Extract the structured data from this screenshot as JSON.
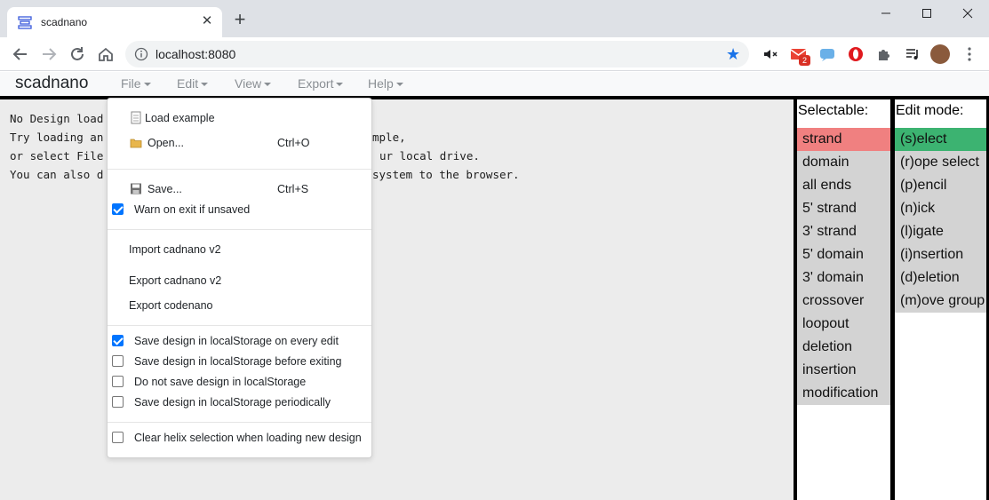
{
  "browser": {
    "tab_title": "scadnano",
    "url": "localhost:8080",
    "gmail_badge": "2"
  },
  "app": {
    "brand": "scadnano",
    "menus": [
      "File",
      "Edit",
      "View",
      "Export",
      "Help"
    ]
  },
  "canvas": {
    "line1": "No Design load",
    "line2": "Try loading an",
    "line2b": "mple,",
    "line3": "or select File",
    "line3b": "ur local drive.",
    "line4": "You can also d",
    "line4b": "system to the browser."
  },
  "file_menu": {
    "load_example": "Load example",
    "open": "Open...",
    "open_shortcut": "Ctrl+O",
    "save": "Save...",
    "save_shortcut": "Ctrl+S",
    "warn_on_exit": "Warn on exit if unsaved",
    "warn_on_exit_checked": true,
    "import_cadnano": "Import cadnano v2",
    "export_cadnano": "Export cadnano v2",
    "export_codenano": "Export codenano",
    "storage_every_edit": "Save design in localStorage on every edit",
    "storage_before_exit": "Save design in localStorage before exiting",
    "storage_none": "Do not save design in localStorage",
    "storage_periodic": "Save design in localStorage periodically",
    "clear_helix": "Clear helix selection when loading new design"
  },
  "selectable": {
    "title": "Selectable:",
    "items": [
      "strand",
      "domain",
      "all ends",
      "5' strand",
      "3' strand",
      "5' domain",
      "3' domain",
      "crossover",
      "loopout",
      "deletion",
      "insertion",
      "modification"
    ],
    "active": "strand"
  },
  "edit_mode": {
    "title": "Edit mode:",
    "items": [
      "(s)elect",
      "(r)ope select",
      "(p)encil",
      "(n)ick",
      "(l)igate",
      "(i)nsertion",
      "(d)eletion",
      "(m)ove group"
    ],
    "active": "(s)elect"
  },
  "colors": {
    "selectable_active": "#f08080",
    "edit_active": "#3cb371",
    "panel_item_bg": "#d3d3d3"
  }
}
